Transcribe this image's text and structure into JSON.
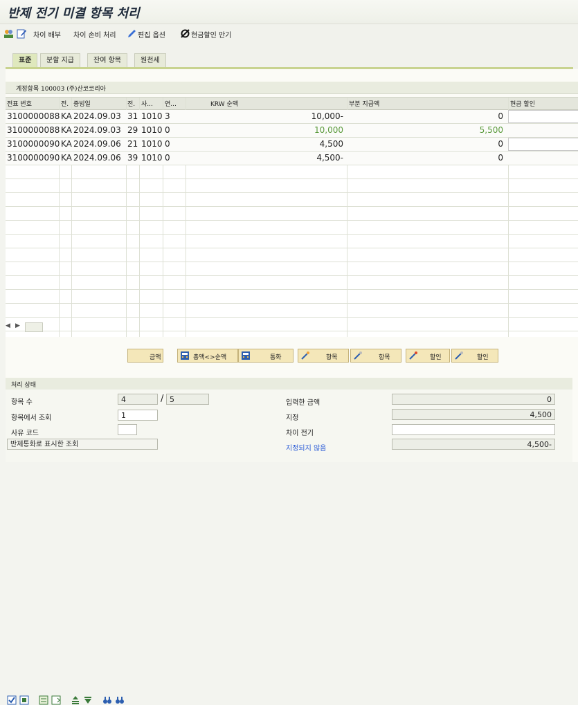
{
  "window": {
    "title": "반제 전기 미결 항목 처리"
  },
  "toolbar": {
    "diff_alloc": "차이 배부",
    "diff_loss": "차이 손비 처리",
    "edit_options": "편집 옵션",
    "cash_discount_due": "현금할인 만기"
  },
  "tabs": [
    {
      "label": "표준",
      "active": true
    },
    {
      "label": "분할 지급",
      "active": false
    },
    {
      "label": "잔여 항목",
      "active": false
    },
    {
      "label": "원천세",
      "active": false
    }
  ],
  "group": {
    "title": "계정항목 100003 (주)산코코리아"
  },
  "table": {
    "headers": [
      "전표 번호",
      "전.",
      "증빙일",
      "전.",
      "사...",
      "연...",
      "KRW 순액",
      "부분 지급액",
      "현금 할인"
    ],
    "rows": [
      {
        "doc": "3100000088",
        "type": "KA",
        "date": "2024.09.03",
        "pk": "31",
        "co": "1010",
        "yr": "3",
        "net": "10,000-",
        "partial": "0",
        "green": false,
        "input": true
      },
      {
        "doc": "3100000088",
        "type": "KA",
        "date": "2024.09.03",
        "pk": "29",
        "co": "1010",
        "yr": "0",
        "net": "10,000",
        "partial": "5,500",
        "green": true,
        "input": false
      },
      {
        "doc": "3100000090",
        "type": "KA",
        "date": "2024.09.06",
        "pk": "21",
        "co": "1010",
        "yr": "0",
        "net": "4,500",
        "partial": "0",
        "green": false,
        "input": true
      },
      {
        "doc": "3100000090",
        "type": "KA",
        "date": "2024.09.06",
        "pk": "39",
        "co": "1010",
        "yr": "0",
        "net": "4,500-",
        "partial": "0",
        "green": false,
        "input": false
      }
    ]
  },
  "buttons": {
    "amount": "금액",
    "gross_net": "총액<>순액",
    "currency": "통화",
    "items1": "항목",
    "items2": "항목",
    "discount1": "할인",
    "discount2": "할인"
  },
  "status": {
    "title": "처리 상태",
    "item_count_label": "항목 수",
    "item_count": "4",
    "item_total": "5",
    "view_in_items_label": "항목에서 조회",
    "view_in_items": "1",
    "reason_code_label": "사유 코드",
    "reason_code": "",
    "clearing_currency_view": "반제통화로 표시한 조회",
    "entered_amount_label": "입력한 금액",
    "entered_amount": "0",
    "assigned_label": "지정",
    "assigned": "4,500",
    "difference_label": "차이 전기",
    "difference": "",
    "unassigned_label": "지정되지 않음",
    "unassigned": "4,500-"
  },
  "colors": {
    "green_text": "#5a9a3b",
    "link_blue": "#2a5bd7",
    "button_bg": "#f4e7b9"
  }
}
